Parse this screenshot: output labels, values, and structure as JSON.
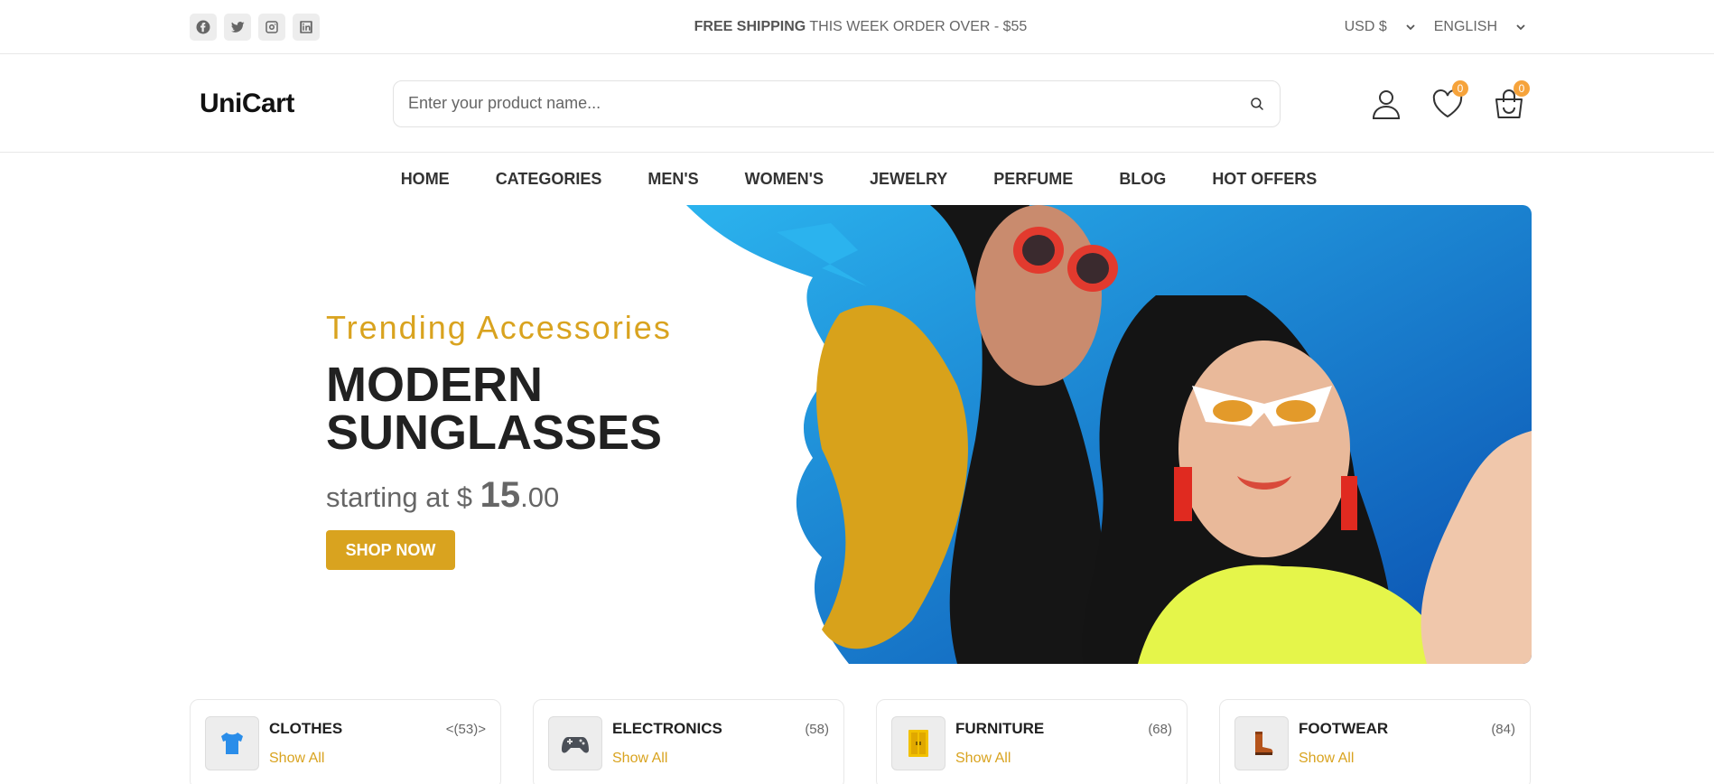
{
  "topbar": {
    "socials": [
      "facebook-icon",
      "twitter-icon",
      "instagram-icon",
      "linkedin-icon"
    ],
    "promo_bold": "FREE SHIPPING",
    "promo_rest": " THIS WEEK ORDER OVER - $55",
    "currency": "USD $",
    "language": "ENGLISH"
  },
  "header": {
    "logo": "UniCart",
    "search_placeholder": "Enter your product name...",
    "wishlist_count": "0",
    "cart_count": "0"
  },
  "nav": [
    "HOME",
    "CATEGORIES",
    "MEN'S",
    "WOMEN'S",
    "JEWELRY",
    "PERFUME",
    "BLOG",
    "HOT OFFERS"
  ],
  "hero": {
    "subtitle": "Trending Accessories",
    "title_line1": "MODERN",
    "title_line2": "SUNGLASSES",
    "price_prefix": "starting at $ ",
    "price_main": "15",
    "price_cents": ".00",
    "button": "SHOP NOW"
  },
  "categories": [
    {
      "name": "CLOTHES",
      "count": "<(53)>",
      "link": "Show All",
      "icon": "tshirt-icon"
    },
    {
      "name": "ELECTRONICS",
      "count": "(58)",
      "link": "Show All",
      "icon": "gamepad-icon"
    },
    {
      "name": "FURNITURE",
      "count": "(68)",
      "link": "Show All",
      "icon": "cabinet-icon"
    },
    {
      "name": "FOOTWEAR",
      "count": "(84)",
      "link": "Show All",
      "icon": "boot-icon"
    }
  ],
  "colors": {
    "accent": "#d9a31f",
    "badge": "#f6a33b",
    "text": "#212121",
    "muted": "#666666"
  }
}
